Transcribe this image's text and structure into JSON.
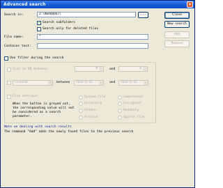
{
  "window": {
    "title": "Advanced search",
    "close_glyph": "×"
  },
  "search_in": {
    "label": "Search in:",
    "value": "Z:\\NEROOO47\\",
    "browse_label": "..."
  },
  "options": {
    "search_subfolders": {
      "label": "Search subfolders",
      "checked": true
    },
    "search_deleted": {
      "label": "Search only for deleted files",
      "checked": false
    }
  },
  "file_name": {
    "label": "File name:",
    "value": "*"
  },
  "contains_text": {
    "label": "Contains text:",
    "value": ""
  },
  "filter": {
    "label": "Use filter during the search",
    "checked": false
  },
  "size": {
    "label": "Size in KB between",
    "min": "0",
    "and_label": "and",
    "max": "0"
  },
  "date": {
    "kind": "Created",
    "between_label": "between",
    "from": "2010-6-25",
    "and_label": "and",
    "to": "2010-6-25"
  },
  "attributes": {
    "label": "File attribut",
    "note": [
      "When the button is greyed out,",
      "the corresponding value will not",
      "be considered as a search",
      "parameter."
    ],
    "items": [
      "System file",
      "Compressed",
      "Directory",
      "Encrypted",
      "Hidden",
      "ReadOnly",
      "Archive",
      "Sparse file"
    ]
  },
  "note": {
    "title": "Note on dealing with search results",
    "text": "The command \"Add\" adds the newly found files to the previous search"
  },
  "buttons": {
    "close": "Close",
    "new_search": "New search",
    "add": "Add",
    "remove": "Remove"
  }
}
